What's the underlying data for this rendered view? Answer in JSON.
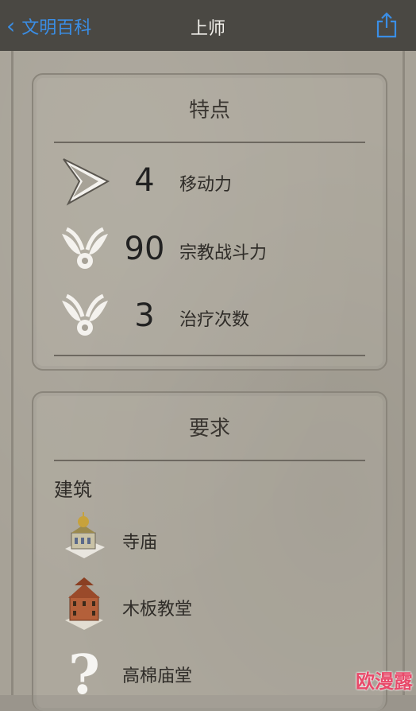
{
  "nav": {
    "back_label": "文明百科",
    "title": "上师"
  },
  "features": {
    "title": "特点",
    "stats": [
      {
        "icon": "movement-arrow-icon",
        "value": "4",
        "label": "移动力"
      },
      {
        "icon": "religious-wings-icon",
        "value": "90",
        "label": "宗教战斗力"
      },
      {
        "icon": "religious-wings-icon",
        "value": "3",
        "label": "治疗次数"
      }
    ]
  },
  "requirements": {
    "title": "要求",
    "section_label": "建筑",
    "items": [
      {
        "icon": "temple-building-icon",
        "label": "寺庙"
      },
      {
        "icon": "wooden-church-icon",
        "label": "木板教堂"
      },
      {
        "icon": "question-mark-icon",
        "label": "高棉庙堂"
      }
    ]
  },
  "watermark": "欧漫露",
  "colors": {
    "navbar": "#4a4843",
    "accent": "#3a8ee6",
    "parchment": "#a7a297",
    "watermark": "#e84a6a"
  }
}
